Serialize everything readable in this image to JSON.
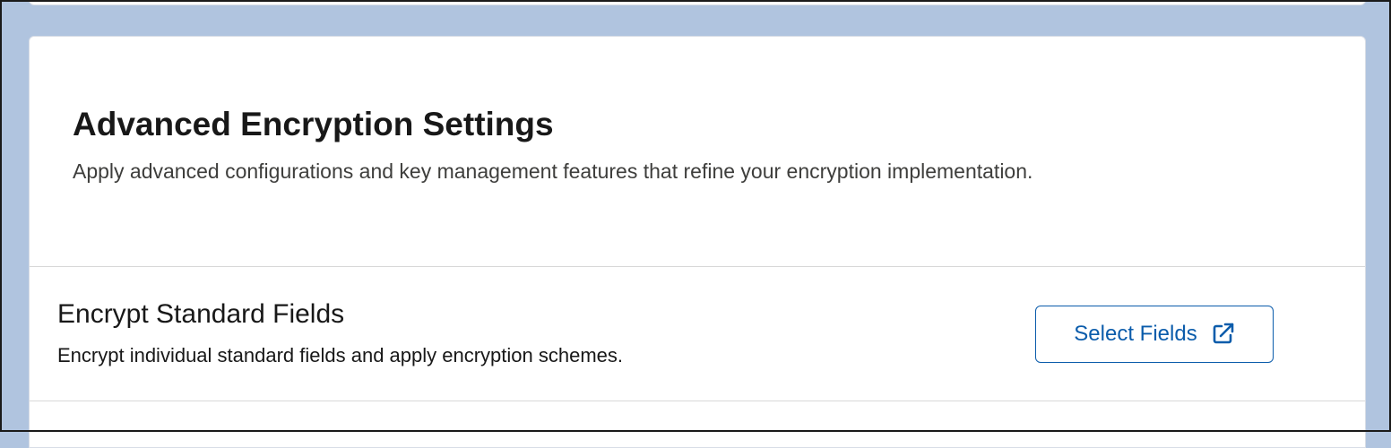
{
  "section": {
    "title": "Advanced Encryption Settings",
    "description": "Apply advanced configurations and key management features that refine your encryption implementation."
  },
  "rows": [
    {
      "title": "Encrypt Standard Fields",
      "description": "Encrypt individual standard fields and apply encryption schemes.",
      "button_label": "Select Fields",
      "button_icon": "external-link-icon"
    }
  ],
  "colors": {
    "page_background": "#b0c4df",
    "card_background": "#ffffff",
    "accent": "#0b5cab",
    "divider": "#d8d8d8"
  }
}
